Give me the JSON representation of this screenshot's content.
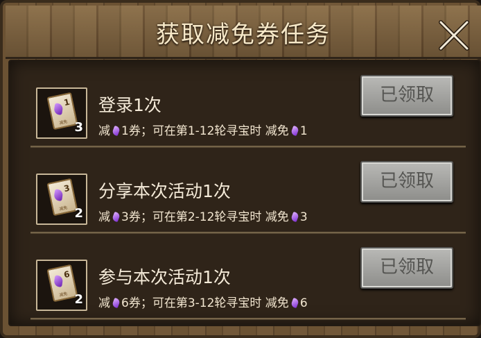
{
  "title": "获取减免券任务",
  "tasks": [
    {
      "name": "登录1次",
      "count": "3",
      "ticket_num": "1",
      "ticket_label": "减免",
      "desc_prefix": "减",
      "desc_amount": "1券；可在第1-12轮寻宝时 减免",
      "desc_reduce": "1",
      "button": "已领取"
    },
    {
      "name": "分享本次活动1次",
      "count": "2",
      "ticket_num": "3",
      "ticket_label": "减免",
      "desc_prefix": "减",
      "desc_amount": "3券；可在第2-12轮寻宝时 减免",
      "desc_reduce": "3",
      "button": "已领取"
    },
    {
      "name": "参与本次活动1次",
      "count": "2",
      "ticket_num": "6",
      "ticket_label": "减免",
      "desc_prefix": "减",
      "desc_amount": "6券；可在第3-12轮寻宝时 减免",
      "desc_reduce": "6",
      "button": "已领取"
    }
  ],
  "icons": {
    "close": "close-icon",
    "gem": "purple-gem-icon",
    "ticket": "ticket-icon"
  },
  "colors": {
    "title_text": "#f6e8c8",
    "button_bg": "#a5a5a2",
    "gem": "#8a3bd6"
  }
}
